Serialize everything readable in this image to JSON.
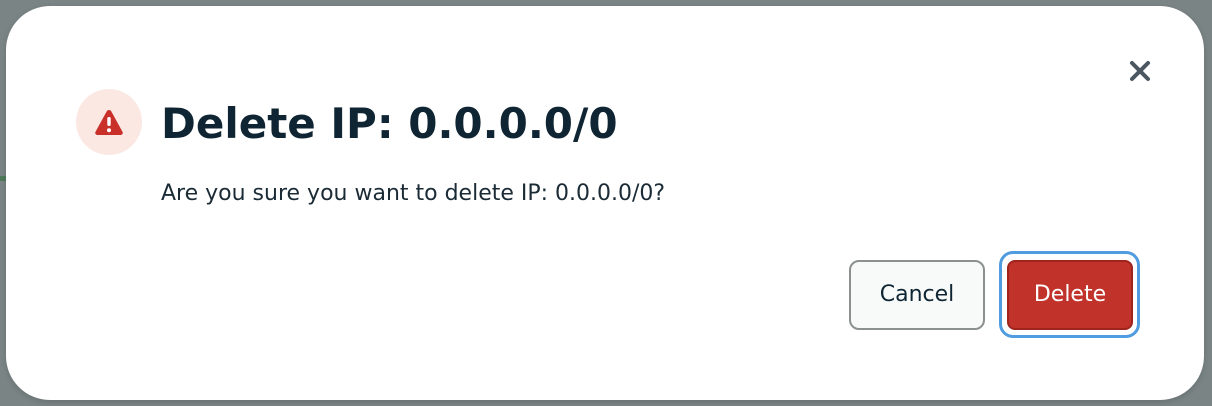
{
  "dialog": {
    "title": "Delete IP: 0.0.0.0/0",
    "message": "Are you sure you want to delete IP: 0.0.0.0/0?",
    "icons": {
      "warning": "warning-triangle-icon",
      "close": "close-icon"
    },
    "buttons": {
      "cancel_label": "Cancel",
      "delete_label": "Delete"
    }
  },
  "colors": {
    "danger": "#c1332a",
    "warning_badge_bg": "#fbe8e3",
    "focus_ring": "#4f9ce0",
    "title_text": "#0f2533"
  }
}
